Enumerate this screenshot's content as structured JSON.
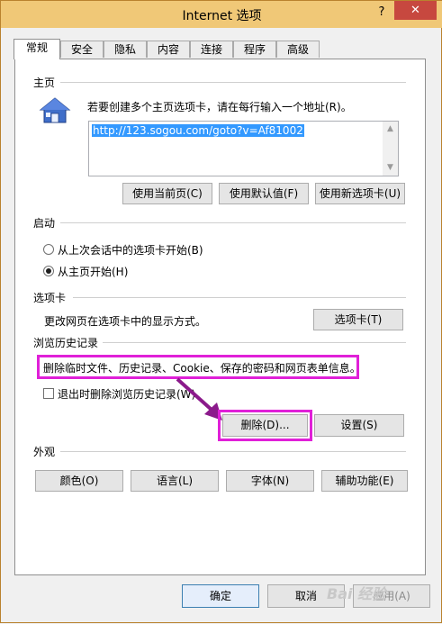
{
  "window": {
    "title": "Internet 选项",
    "help_label": "?",
    "close_label": "✕"
  },
  "tabs": [
    {
      "label": "常规",
      "active": true
    },
    {
      "label": "安全"
    },
    {
      "label": "隐私"
    },
    {
      "label": "内容"
    },
    {
      "label": "连接"
    },
    {
      "label": "程序"
    },
    {
      "label": "高级"
    }
  ],
  "home": {
    "group": "主页",
    "description": "若要创建多个主页选项卡，请在每行输入一个地址(R)。",
    "url": "http://123.sogou.com/goto?v=Af81002",
    "buttons": {
      "current": "使用当前页(C)",
      "default": "使用默认值(F)",
      "newtab": "使用新选项卡(U)"
    },
    "icon": "house-icon"
  },
  "startup": {
    "group": "启动",
    "options": [
      {
        "label": "从上次会话中的选项卡开始(B)",
        "selected": false
      },
      {
        "label": "从主页开始(H)",
        "selected": true
      }
    ]
  },
  "tabs_section": {
    "group": "选项卡",
    "description": "更改网页在选项卡中的显示方式。",
    "button": "选项卡(T)"
  },
  "history": {
    "group": "浏览历史记录",
    "description": "删除临时文件、历史记录、Cookie、保存的密码和网页表单信息。",
    "checkbox": "退出时删除浏览历史记录(W)",
    "delete_button": "删除(D)...",
    "settings_button": "设置(S)"
  },
  "appearance": {
    "group": "外观",
    "buttons": {
      "colors": "颜色(O)",
      "languages": "语言(L)",
      "fonts": "字体(N)",
      "accessibility": "辅助功能(E)"
    }
  },
  "footer": {
    "ok": "确定",
    "cancel": "取消",
    "apply": "应用(A)"
  },
  "watermark": "Bai 经验",
  "colors": {
    "titlebar": "#f0c877",
    "close": "#c7483f",
    "highlight": "#e020d8",
    "selection": "#3399ff"
  }
}
